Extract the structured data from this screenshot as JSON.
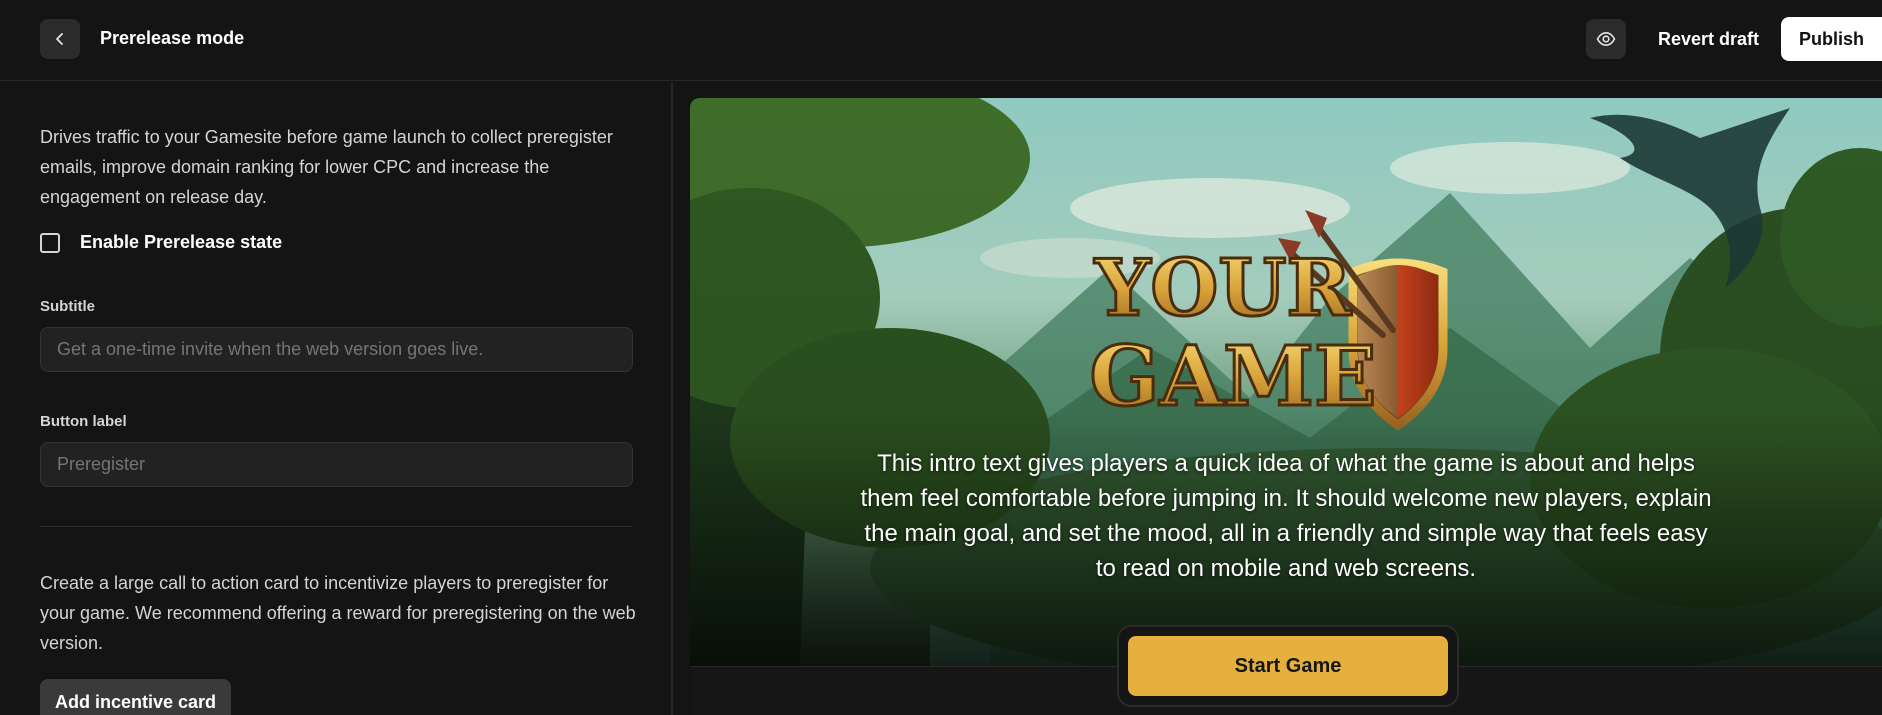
{
  "header": {
    "back_icon": "chevron-left-icon",
    "title": "Prerelease mode",
    "preview_icon": "eye-icon",
    "revert_label": "Revert draft",
    "publish_label": "Publish"
  },
  "settings": {
    "description": "Drives traffic to your Gamesite before game launch to collect preregister emails, improve domain ranking for lower CPC and increase the engagement on release day.",
    "enable_checkbox": {
      "label": "Enable Prerelease state",
      "checked": false
    },
    "subtitle": {
      "label": "Subtitle",
      "placeholder": "Get a one-time invite when the web version goes live."
    },
    "button_label": {
      "label": "Button label",
      "placeholder": "Preregister"
    },
    "incentive_description": "Create a large call to action card to incentivize players to preregister for your game. We recommend offering a reward for preregistering on the web version.",
    "incentive_button_label": "Add incentive card"
  },
  "preview": {
    "logo_text": "YOUR GAME",
    "intro_text": "This intro text gives players a quick idea of what the game is about and helps them feel comfortable before jumping in. It should welcome new players, explain the main goal, and set the mood, all in a friendly and simple way that feels easy to read on mobile and web screens.",
    "start_button_label": "Start Game"
  },
  "colors": {
    "background": "#141414",
    "panel_surface": "#222222",
    "accent": "#e5b03d",
    "publish_bg": "#ffffff"
  }
}
